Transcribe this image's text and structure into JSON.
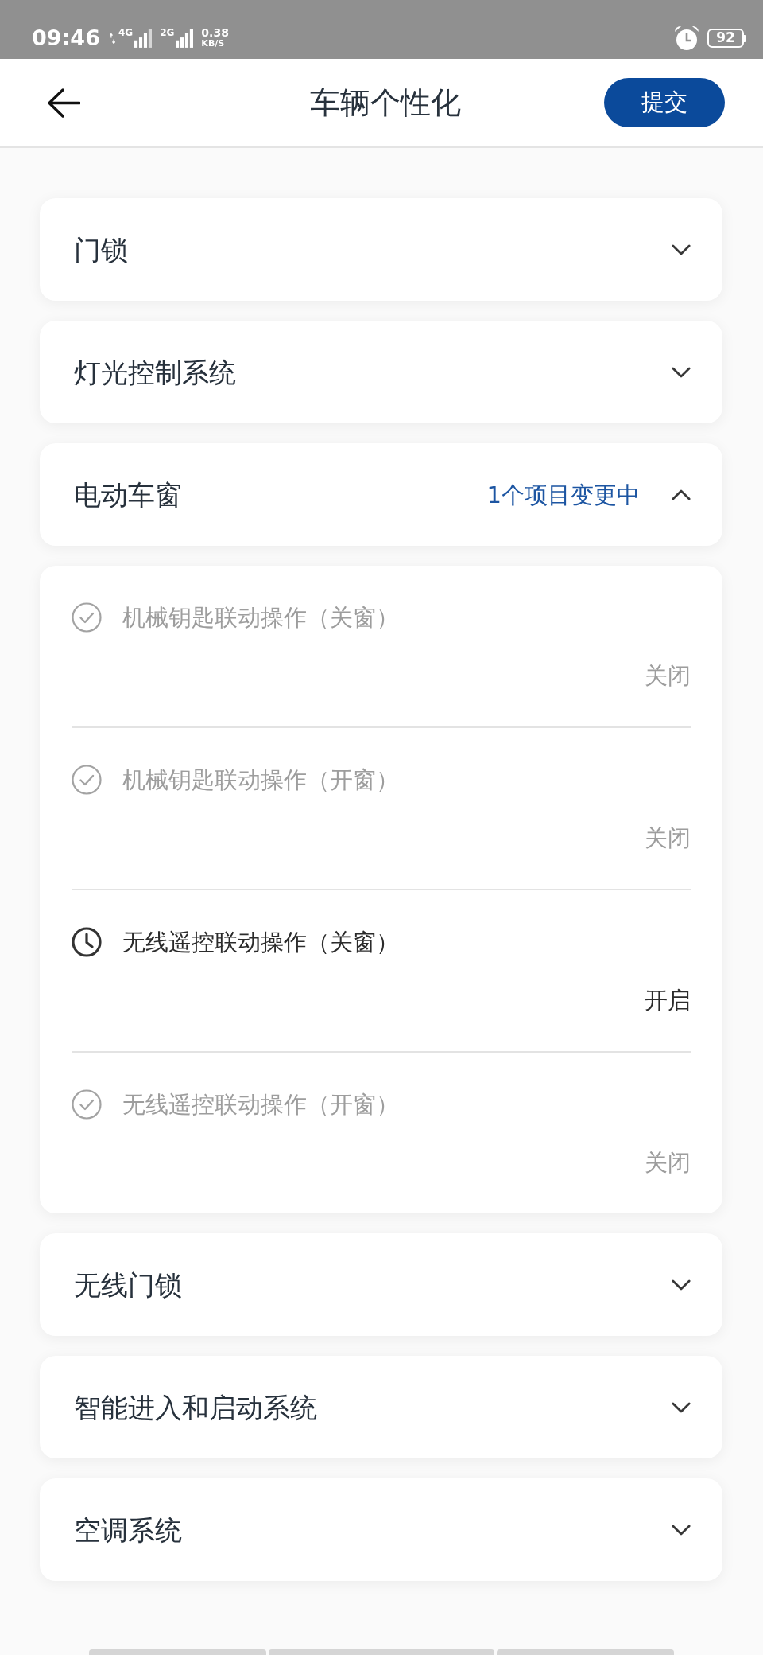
{
  "status_bar": {
    "time": "09:46",
    "signals": [
      {
        "label": "4G"
      },
      {
        "label": "2G"
      }
    ],
    "speed": "0.38",
    "speed_unit": "KB/S",
    "battery": "92"
  },
  "header": {
    "title": "车辆个性化",
    "submit_button": "提交"
  },
  "sections": [
    {
      "title": "门锁",
      "expanded": false
    },
    {
      "title": "灯光控制系统",
      "expanded": false
    },
    {
      "title": "电动车窗",
      "expanded": true,
      "status": "1个项目变更中",
      "items": [
        {
          "label": "机械钥匙联动操作（关窗）",
          "value": "关闭",
          "pending": false
        },
        {
          "label": "机械钥匙联动操作（开窗）",
          "value": "关闭",
          "pending": false
        },
        {
          "label": "无线遥控联动操作（关窗）",
          "value": "开启",
          "pending": true
        },
        {
          "label": "无线遥控联动操作（开窗）",
          "value": "关闭",
          "pending": false
        }
      ]
    },
    {
      "title": "无线门锁",
      "expanded": false
    },
    {
      "title": "智能进入和启动系统",
      "expanded": false
    },
    {
      "title": "空调系统",
      "expanded": false
    }
  ]
}
